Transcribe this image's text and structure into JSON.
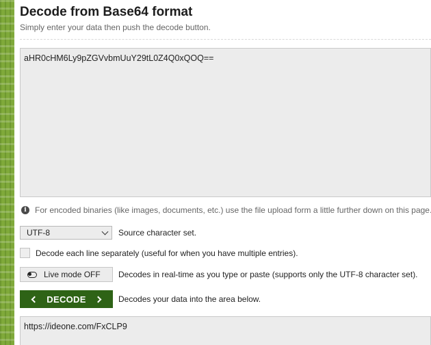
{
  "header": {
    "title": "Decode from Base64 format",
    "subtitle": "Simply enter your data then push the decode button."
  },
  "input": {
    "value": "aHR0cHM6Ly9pZGVvbmUuY29tL0Z4Q0xQOQ=="
  },
  "info": {
    "text": "For encoded binaries (like images, documents, etc.) use the file upload form a little further down on this page."
  },
  "charset": {
    "selected": "UTF-8",
    "label": "Source character set."
  },
  "each_line": {
    "label": "Decode each line separately (useful for when you have multiple entries).",
    "checked": false
  },
  "live_mode": {
    "button_label": "Live mode OFF",
    "description": "Decodes in real-time as you type or paste (supports only the UTF-8 character set)."
  },
  "decode": {
    "button_label": "DECODE",
    "description": "Decodes your data into the area below."
  },
  "output": {
    "value": "https://ideone.com/FxCLP9"
  },
  "colors": {
    "decode_button": "#2e6316",
    "side_strip": "#7fa93a"
  },
  "icons": [
    "info-icon",
    "chevron-down-icon",
    "toggle-icon",
    "chevron-left-icon",
    "chevron-right-icon"
  ]
}
